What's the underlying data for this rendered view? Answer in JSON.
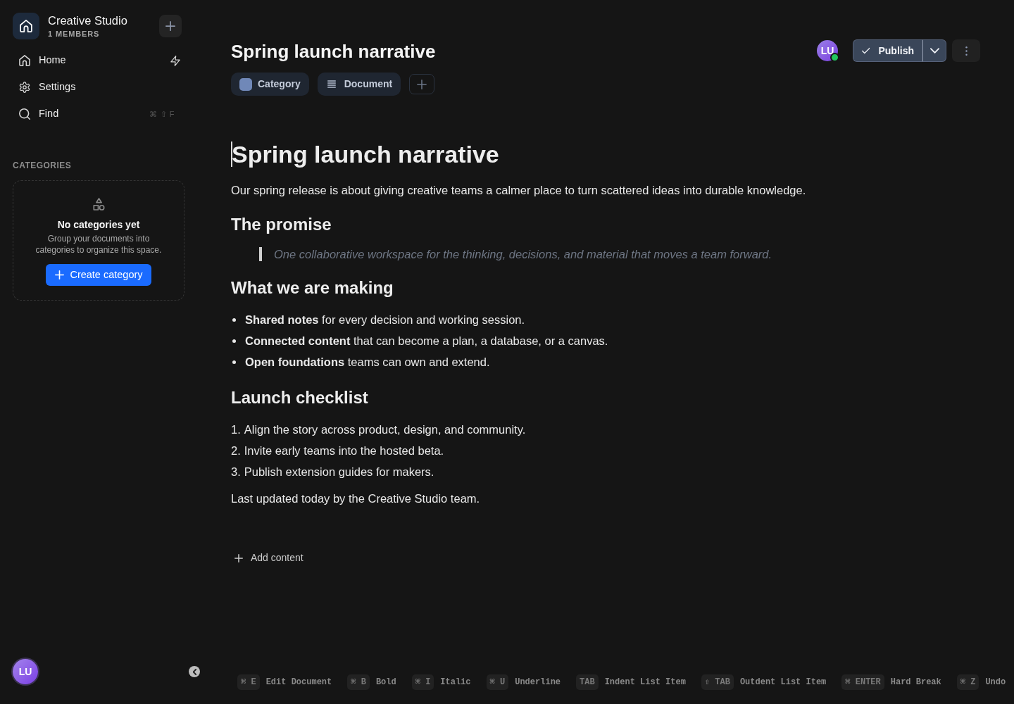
{
  "sidebar": {
    "workspace": {
      "name": "Creative Studio",
      "members": "1 MEMBERS"
    },
    "nav": [
      {
        "kind": "home",
        "label": "Home"
      },
      {
        "kind": "settings",
        "label": "Settings"
      },
      {
        "kind": "find",
        "label": "Find",
        "shortcut": "⌘ ⇧ F"
      }
    ],
    "categories": {
      "heading": "CATEGORIES",
      "empty_title": "No categories yet",
      "empty_text": "Group your documents into categories to organize this space.",
      "button": "Create category"
    },
    "user": {
      "initials": "LU"
    }
  },
  "header": {
    "title": "Spring launch narrative",
    "tags": [
      {
        "kind": "category",
        "label": "Category",
        "color": "#7088b8"
      },
      {
        "kind": "document",
        "label": "Document"
      }
    ],
    "collaborator": {
      "initials": "LU",
      "online": true
    },
    "publish": "Publish"
  },
  "document": {
    "blocks": [
      {
        "kind": "heading1",
        "text": "Spring launch narrative",
        "caret": true
      },
      {
        "kind": "paragraph",
        "text": "Our spring release is about giving creative teams a calmer place to turn scattered ideas into durable knowledge.",
        "caret": false
      },
      {
        "kind": "heading2",
        "text": "The promise",
        "caret": false
      },
      {
        "kind": "quote",
        "text": "One collaborative workspace for the thinking, decisions, and material that moves a team forward.",
        "caret": false
      },
      {
        "kind": "heading2",
        "text": "What we are making",
        "caret": false
      },
      {
        "kind": "bullets",
        "items": [
          "**Shared notes** for every decision and working session.",
          "**Connected content** that can become a plan, a database, or a canvas.",
          "**Open foundations** teams can own and extend."
        ]
      },
      {
        "kind": "heading2",
        "text": "Launch checklist",
        "caret": false
      },
      {
        "kind": "numbered",
        "items": [
          {
            "number": "1.",
            "text": "Align the story across product, design, and community."
          },
          {
            "number": "2.",
            "text": "Invite early teams into the hosted beta."
          },
          {
            "number": "3.",
            "text": "Publish extension guides for makers."
          }
        ]
      },
      {
        "kind": "paragraph",
        "text": "Last updated today by the Creative Studio team.",
        "caret": false
      }
    ],
    "add_content": "Add content"
  },
  "shortcuts": [
    {
      "keys": "⌘ E",
      "label": "Edit Document"
    },
    {
      "keys": "⌘ B",
      "label": "Bold"
    },
    {
      "keys": "⌘ I",
      "label": "Italic"
    },
    {
      "keys": "⌘ U",
      "label": "Underline"
    },
    {
      "keys": "TAB",
      "label": "Indent List Item"
    },
    {
      "keys": "⇧ TAB",
      "label": "Outdent List Item"
    },
    {
      "keys": "⌘ ENTER",
      "label": "Hard Break"
    },
    {
      "keys": "⌘ Z",
      "label": "Undo"
    }
  ]
}
